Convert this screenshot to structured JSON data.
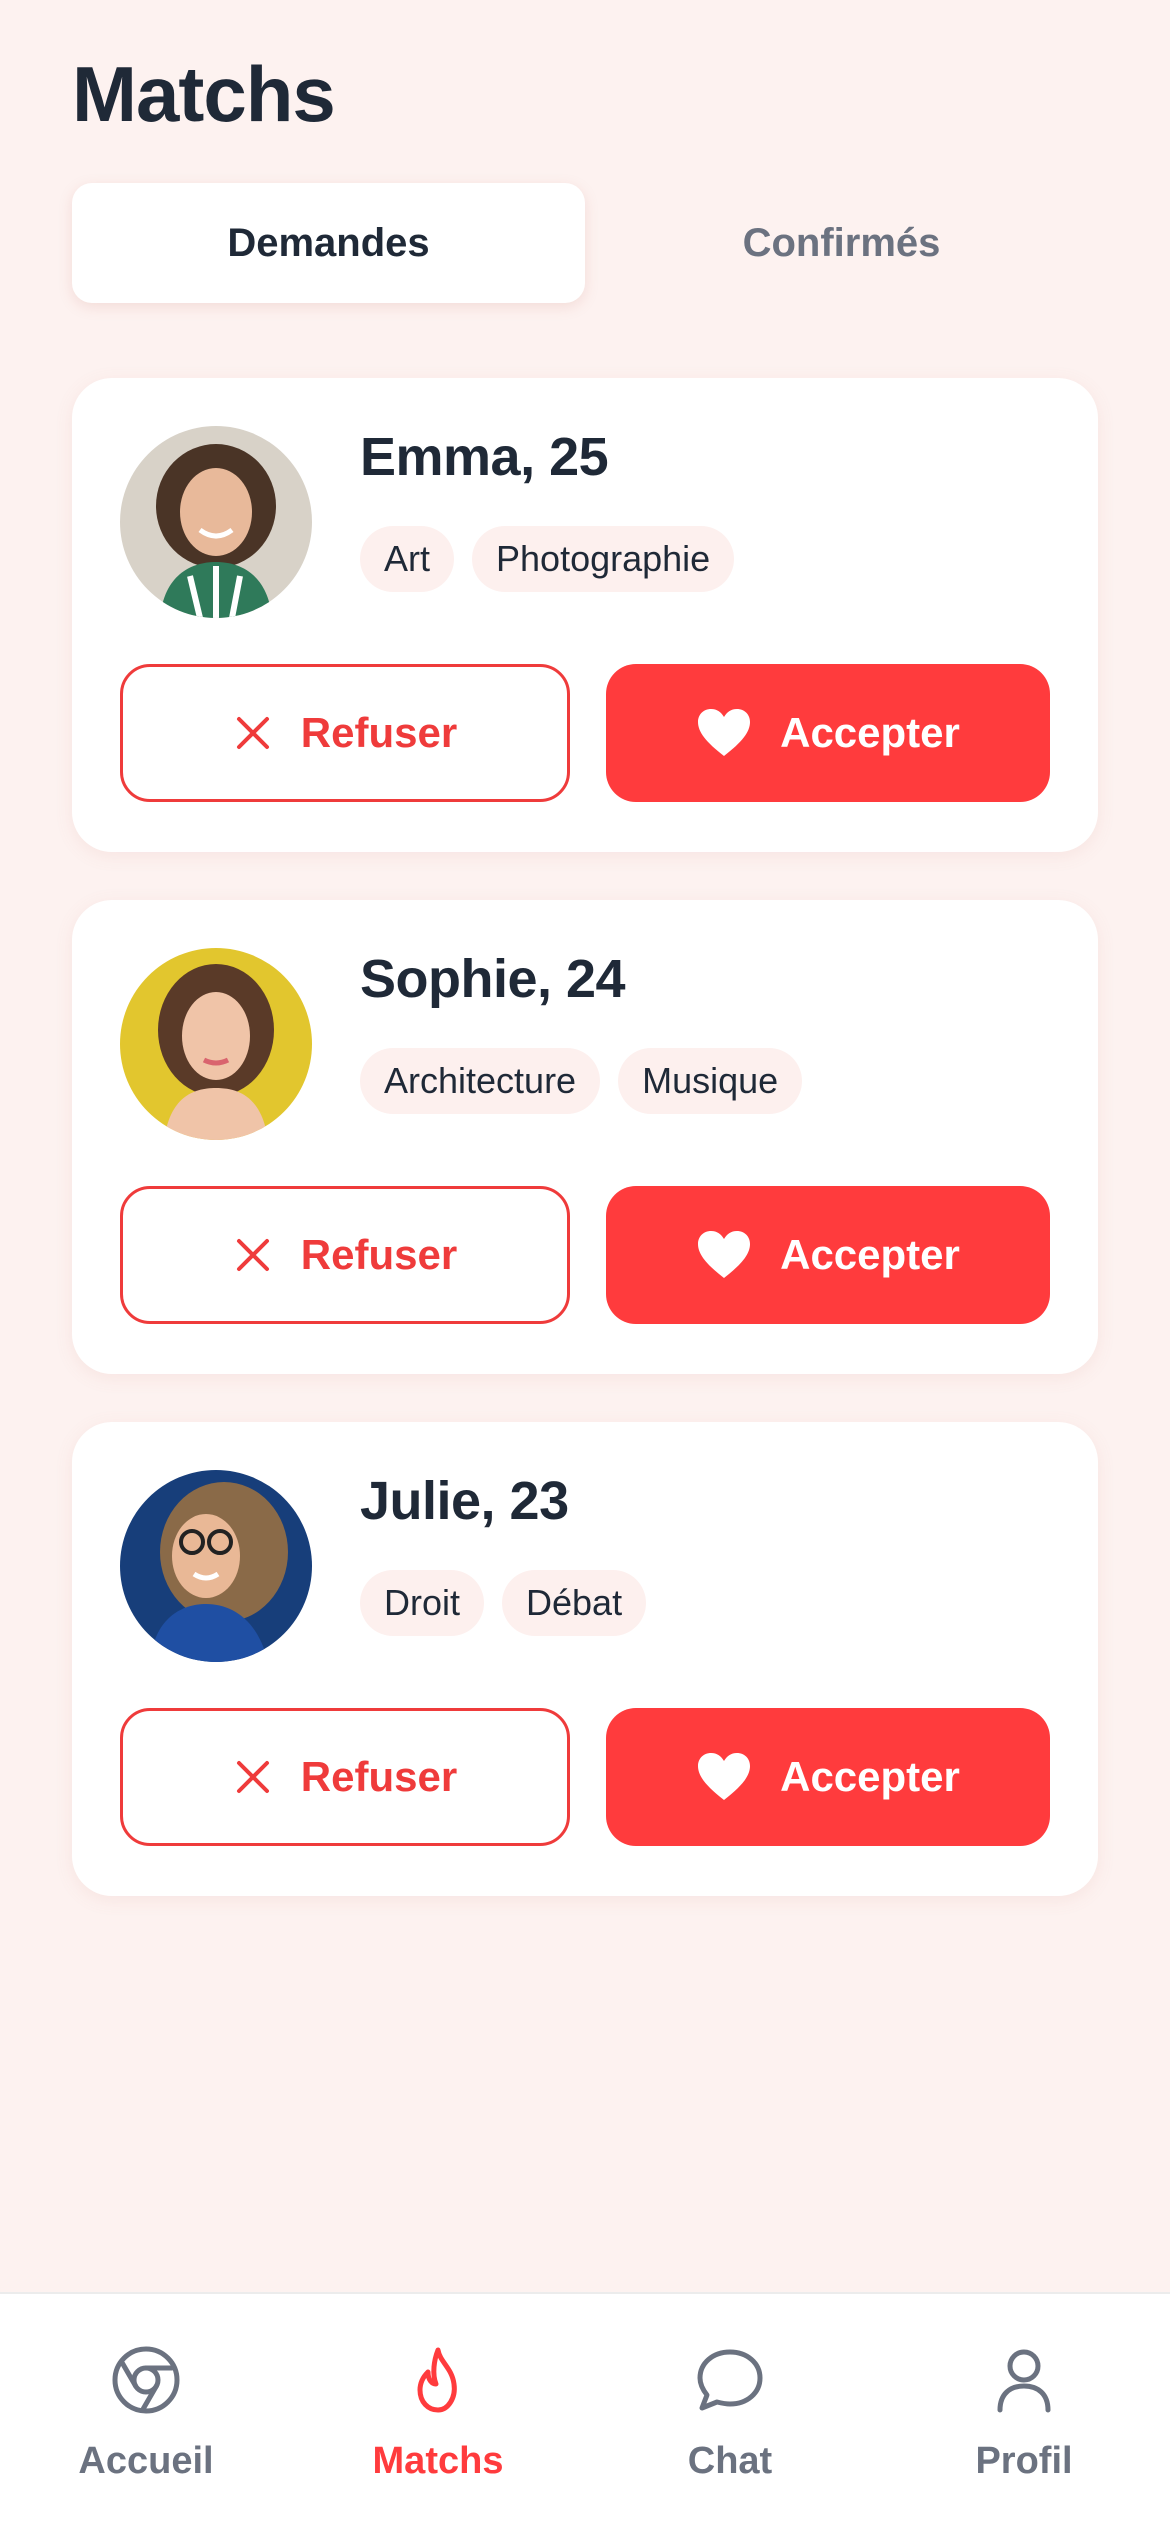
{
  "header": {
    "title": "Matchs"
  },
  "tabs": [
    {
      "label": "Demandes",
      "active": true
    },
    {
      "label": "Confirmés",
      "active": false
    }
  ],
  "requests": [
    {
      "name": "Emma, 25",
      "tags": [
        "Art",
        "Photographie"
      ],
      "refuse_label": "Refuser",
      "accept_label": "Accepter"
    },
    {
      "name": "Sophie, 24",
      "tags": [
        "Architecture",
        "Musique"
      ],
      "refuse_label": "Refuser",
      "accept_label": "Accepter"
    },
    {
      "name": "Julie, 23",
      "tags": [
        "Droit",
        "Débat"
      ],
      "refuse_label": "Refuser",
      "accept_label": "Accepter"
    }
  ],
  "nav": {
    "items": [
      {
        "label": "Accueil",
        "icon": "home-icon"
      },
      {
        "label": "Matchs",
        "icon": "flame-icon",
        "active": true
      },
      {
        "label": "Chat",
        "icon": "chat-icon"
      },
      {
        "label": "Profil",
        "icon": "profile-icon"
      }
    ]
  },
  "colors": {
    "background": "#fdf2f0",
    "accent": "#ff3b3d",
    "text_primary": "#1f2937",
    "text_secondary": "#6b7280"
  }
}
